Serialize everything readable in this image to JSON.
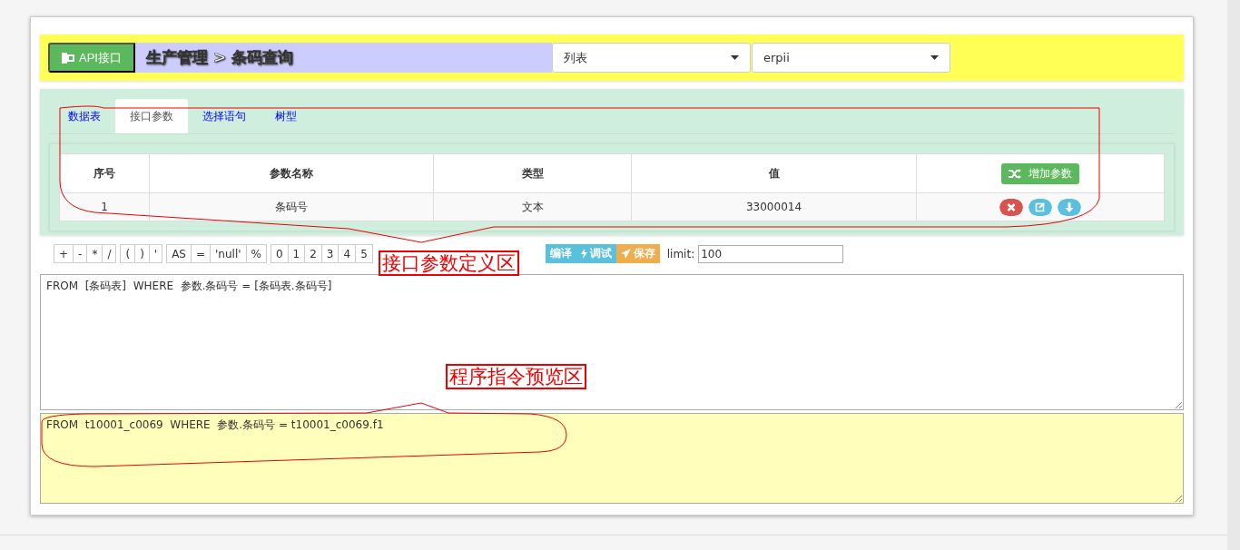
{
  "header": {
    "api_button": "API接口",
    "breadcrumb": "生产管理 > 条码查询",
    "selects": [
      {
        "value": "列表"
      },
      {
        "value": "erpii"
      }
    ]
  },
  "tabs": [
    {
      "label": "数据表",
      "selected": false
    },
    {
      "label": "接口参数",
      "selected": true
    },
    {
      "label": "选择语句",
      "selected": false
    },
    {
      "label": "树型",
      "selected": false
    }
  ],
  "params_table": {
    "columns": [
      "序号",
      "参数名称",
      "类型",
      "值"
    ],
    "add_button": "增加参数",
    "rows": [
      {
        "cells": [
          "1",
          "条码号",
          "文本",
          "33000014"
        ]
      }
    ]
  },
  "toolbar": {
    "key_groups": [
      [
        "+",
        "-",
        "*",
        "/"
      ],
      [
        "(",
        ")",
        "'"
      ],
      [
        "AS",
        "=",
        "'null'",
        "%"
      ],
      [
        "0",
        "1",
        "2",
        "3",
        "4",
        "5"
      ]
    ],
    "actions": [
      {
        "kind": "compile",
        "label": "编译"
      },
      {
        "kind": "debug",
        "label": "调试"
      },
      {
        "kind": "save",
        "label": "保存"
      }
    ],
    "limit_label": "limit:",
    "limit_value": "100"
  },
  "sql_editor": "FROM  [条码表]  WHERE  参数.条码号 = [条码表.条码号]",
  "preview": "FROM  t10001_c0069  WHERE  参数.条码号 = t10001_c0069.f1",
  "annotations": [
    {
      "label": "接口参数定义区"
    },
    {
      "label": "程序指令预览区"
    }
  ]
}
